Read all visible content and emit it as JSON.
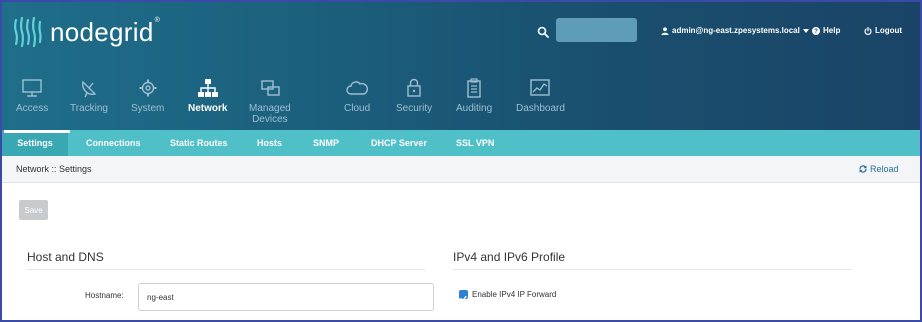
{
  "brand": {
    "name": "nodegrid",
    "registered": "®"
  },
  "header": {
    "search_placeholder": "",
    "user": "admin@ng-east.zpesystems.local",
    "help": "Help",
    "logout": "Logout"
  },
  "nav": {
    "items": [
      {
        "label": "Access",
        "icon": "monitor-icon"
      },
      {
        "label": "Tracking",
        "icon": "satellite-dish-icon"
      },
      {
        "label": "System",
        "icon": "gear-icon"
      },
      {
        "label": "Network",
        "icon": "network-tree-icon",
        "active": true
      },
      {
        "label": "Managed Devices",
        "icon": "devices-icon"
      },
      {
        "label": "Cloud",
        "icon": "cloud-icon"
      },
      {
        "label": "Security",
        "icon": "lock-icon"
      },
      {
        "label": "Auditing",
        "icon": "clipboard-icon"
      },
      {
        "label": "Dashboard",
        "icon": "chart-icon"
      }
    ]
  },
  "subnav": {
    "items": [
      {
        "label": "Settings",
        "active": true
      },
      {
        "label": "Connections"
      },
      {
        "label": "Static Routes"
      },
      {
        "label": "Hosts"
      },
      {
        "label": "SNMP"
      },
      {
        "label": "DHCP Server"
      },
      {
        "label": "SSL VPN"
      }
    ]
  },
  "breadcrumb": {
    "text": "Network :: Settings",
    "reload": "Reload"
  },
  "toolbar": {
    "save": "Save"
  },
  "host_dns": {
    "title": "Host and DNS",
    "hostname_label": "Hostname:",
    "hostname_value": "ng-east"
  },
  "ip_profile": {
    "title": "IPv4 and IPv6 Profile",
    "ipv4_forward_label": "Enable IPv4 IP Forward",
    "ipv4_forward_checked": true
  },
  "colors": {
    "header_start": "#1f6e8a",
    "header_end": "#1a4467",
    "subnav": "#4fbfc8",
    "accent_blue": "#2d7fd3"
  }
}
